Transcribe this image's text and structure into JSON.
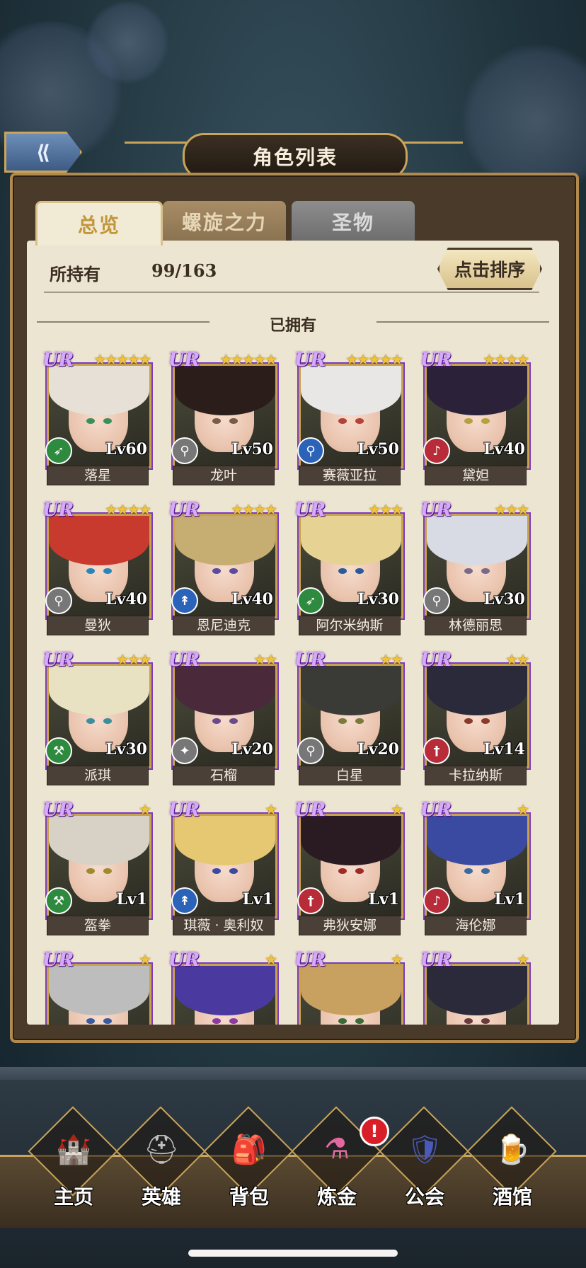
{
  "header": {
    "title": "角色列表",
    "back_label": "⟪"
  },
  "tabs": [
    {
      "label": "总览",
      "active": true
    },
    {
      "label": "螺旋之力",
      "active": false
    },
    {
      "label": "圣物",
      "active": false
    }
  ],
  "summary": {
    "owned_label": "所持有",
    "owned_count": "99/163",
    "sort_label": "点击排序"
  },
  "section_title": "已拥有",
  "colors": {
    "rarity": "#d8a8ff",
    "star": "#f0c33c",
    "frame": "#c9a24e",
    "badge": "#d81f28"
  },
  "heroes": [
    {
      "rarity": "UR",
      "stars": 5,
      "class_icon": "bow-icon",
      "level": "Lv60",
      "name": "落星"
    },
    {
      "rarity": "UR",
      "stars": 5,
      "class_icon": "staff-icon",
      "level": "Lv50",
      "name": "龙叶"
    },
    {
      "rarity": "UR",
      "stars": 5,
      "class_icon": "mage-staff-icon",
      "level": "Lv50",
      "name": "赛薇亚拉"
    },
    {
      "rarity": "UR",
      "stars": 4,
      "class_icon": "lyre-icon",
      "level": "Lv40",
      "name": "黛妲"
    },
    {
      "rarity": "UR",
      "stars": 4,
      "class_icon": "staff-icon",
      "level": "Lv40",
      "name": "曼狄"
    },
    {
      "rarity": "UR",
      "stars": 4,
      "class_icon": "spear-icon",
      "level": "Lv40",
      "name": "恩尼迪克"
    },
    {
      "rarity": "UR",
      "stars": 3,
      "class_icon": "bow-icon",
      "level": "Lv30",
      "name": "阿尔米纳斯"
    },
    {
      "rarity": "UR",
      "stars": 3,
      "class_icon": "staff-icon",
      "level": "Lv30",
      "name": "林德丽思"
    },
    {
      "rarity": "UR",
      "stars": 3,
      "class_icon": "axe-icon",
      "level": "Lv30",
      "name": "派琪"
    },
    {
      "rarity": "UR",
      "stars": 2,
      "class_icon": "gun-icon",
      "level": "Lv20",
      "name": "石榴"
    },
    {
      "rarity": "UR",
      "stars": 2,
      "class_icon": "staff-icon",
      "level": "Lv20",
      "name": "白星"
    },
    {
      "rarity": "UR",
      "stars": 2,
      "class_icon": "sword-icon",
      "level": "Lv14",
      "name": "卡拉纳斯"
    },
    {
      "rarity": "UR",
      "stars": 1,
      "class_icon": "axe-icon",
      "level": "Lv1",
      "name": "盔拳"
    },
    {
      "rarity": "UR",
      "stars": 1,
      "class_icon": "spear-icon",
      "level": "Lv1",
      "name": "琪薇 · 奥利奴"
    },
    {
      "rarity": "UR",
      "stars": 1,
      "class_icon": "sword-icon",
      "level": "Lv1",
      "name": "弗狄安娜"
    },
    {
      "rarity": "UR",
      "stars": 1,
      "class_icon": "lyre-icon",
      "level": "Lv1",
      "name": "海伦娜"
    },
    {
      "rarity": "UR",
      "stars": 1,
      "class_icon": "",
      "level": "",
      "name": ""
    },
    {
      "rarity": "UR",
      "stars": 1,
      "class_icon": "",
      "level": "",
      "name": ""
    },
    {
      "rarity": "UR",
      "stars": 1,
      "class_icon": "",
      "level": "",
      "name": ""
    },
    {
      "rarity": "UR",
      "stars": 1,
      "class_icon": "",
      "level": "",
      "name": ""
    }
  ],
  "nav": [
    {
      "label": "主页",
      "icon": "castle-icon"
    },
    {
      "label": "英雄",
      "icon": "helmet-icon"
    },
    {
      "label": "背包",
      "icon": "bag-icon"
    },
    {
      "label": "炼金",
      "icon": "potion-icon",
      "badge": "!"
    },
    {
      "label": "公会",
      "icon": "shield-icon"
    },
    {
      "label": "酒馆",
      "icon": "beer-icon"
    }
  ]
}
